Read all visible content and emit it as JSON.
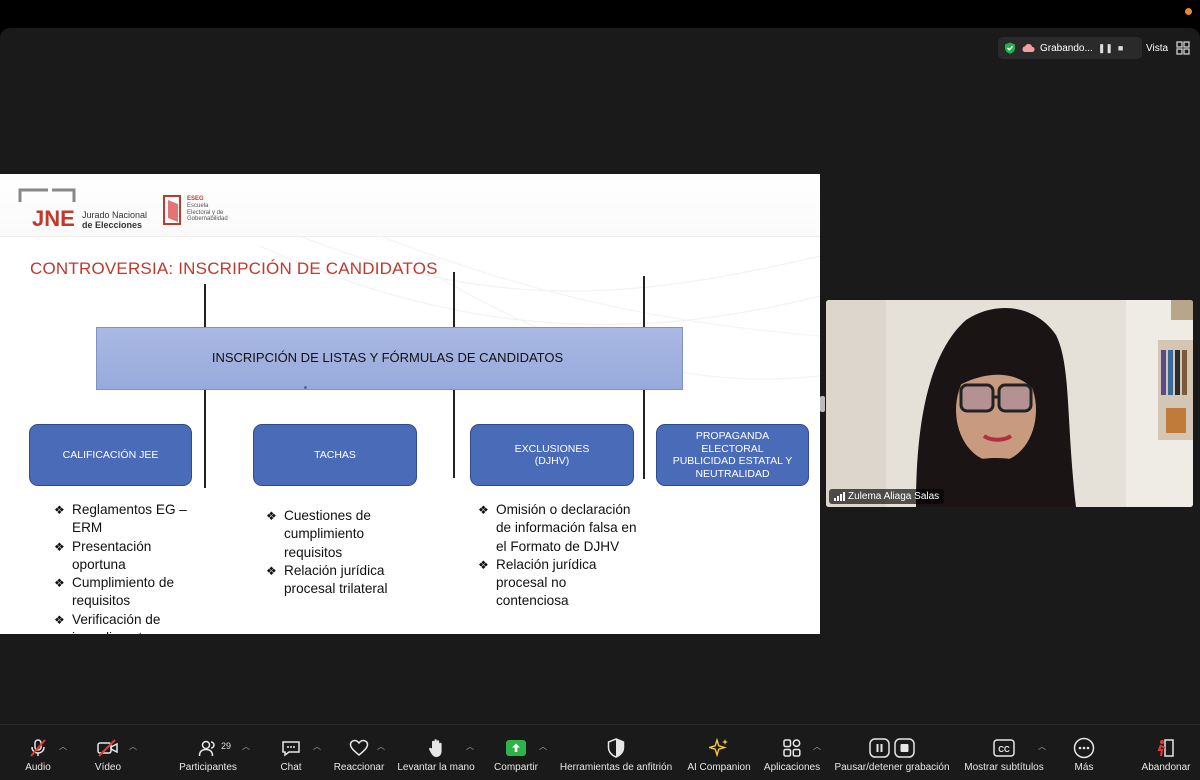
{
  "window": {
    "accent_dot": "#e8873b"
  },
  "recording": {
    "label": "Grabando...",
    "shield_color": "#22b14c"
  },
  "view": {
    "label": "Vista"
  },
  "slide": {
    "logo_jne_line1": "Jurado Nacional",
    "logo_jne_line2": "de Elecciones",
    "logo_jne_mark": "JNE",
    "logo_eseg_lines": [
      "ESEG",
      "Escuela",
      "Electoral y de",
      "Gobernabilidad"
    ],
    "title": "CONTROVERSIA: INSCRIPCIÓN DE CANDIDATOS",
    "top_box": "INSCRIPCIÓN DE LISTAS Y FÓRMULAS DE CANDIDATOS",
    "categories": [
      {
        "label": "CALIFICACIÓN JEE"
      },
      {
        "label": "TACHAS"
      },
      {
        "label_lines": [
          "EXCLUSIONES",
          "(DJHV)"
        ]
      },
      {
        "label_lines": [
          "PROPAGANDA",
          "ELECTORAL",
          "PUBLICIDAD ESTATAL Y",
          "NEUTRALIDAD"
        ]
      }
    ],
    "bullets_1": [
      "Reglamentos EG – ERM",
      "Presentación oportuna",
      "Cumplimiento de requisitos",
      "Verificación de impedimentos"
    ],
    "bullets_2": [
      "Cuestiones de cumplimiento requisitos",
      "Relación jurídica procesal trilateral"
    ],
    "bullets_3": [
      "Omisión o declaración de información falsa en el Formato de DJHV",
      "Relación jurídica procesal no contenciosa"
    ],
    "colors": {
      "title": "#c0392b",
      "category_fill": "#4a6bb8",
      "top_box": "#a1b2e0"
    }
  },
  "participant": {
    "name": "Zulema Aliaga Salas"
  },
  "toolbar": {
    "audio": "Audio",
    "video": "Vídeo",
    "participants": "Participantes",
    "participants_count": "29",
    "chat": "Chat",
    "react": "Reaccionar",
    "raise_hand": "Levantar la mano",
    "share": "Compartir",
    "host_tools": "Herramientas de anfitrión",
    "ai": "AI Companion",
    "apps": "Aplicaciones",
    "record": "Pausar/detener grabación",
    "captions": "Mostrar subtítulos",
    "more": "Más",
    "leave": "Abandonar",
    "share_color": "#2fb24a",
    "ai_color": "#f2c94c",
    "leave_color": "#e53935"
  }
}
